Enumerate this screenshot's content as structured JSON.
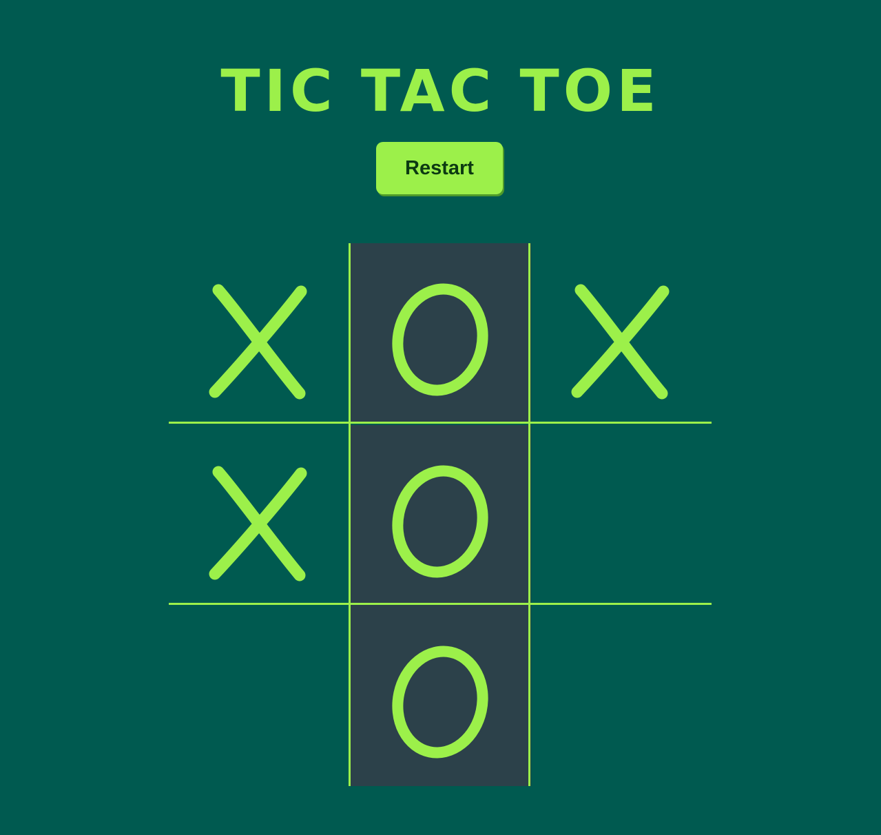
{
  "title": "TIC TAC TOE",
  "restart_label": "Restart",
  "colors": {
    "background": "#005a50",
    "accent": "#9cf04a",
    "win_cell": "#2c414a",
    "button_text": "#0c3a12"
  },
  "board": {
    "cells": [
      {
        "mark": "X",
        "winning": false
      },
      {
        "mark": "O",
        "winning": true
      },
      {
        "mark": "X",
        "winning": false
      },
      {
        "mark": "X",
        "winning": false
      },
      {
        "mark": "O",
        "winning": true
      },
      {
        "mark": "",
        "winning": false
      },
      {
        "mark": "",
        "winning": false
      },
      {
        "mark": "O",
        "winning": true
      },
      {
        "mark": "",
        "winning": false
      }
    ]
  }
}
